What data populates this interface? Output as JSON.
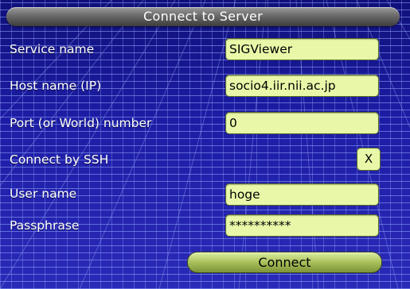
{
  "title": "Connect to Server",
  "fields": {
    "service_name": {
      "label": "Service name",
      "value": "SIGViewer"
    },
    "host_name": {
      "label": "Host name (IP)",
      "value": "socio4.iir.nii.ac.jp"
    },
    "port": {
      "label": "Port (or World) number",
      "value": "0"
    },
    "ssh": {
      "label": "Connect by SSH",
      "value": "X"
    },
    "user_name": {
      "label": "User name",
      "value": "hoge"
    },
    "passphrase": {
      "label": "Passphrase",
      "value": "**********"
    }
  },
  "connect_label": "Connect",
  "colors": {
    "background": "#1c1ca4",
    "grid": "#96aaff",
    "field": "#e8f8a8",
    "button": "#a8c05a",
    "title_bar": "#6a6a6a"
  }
}
